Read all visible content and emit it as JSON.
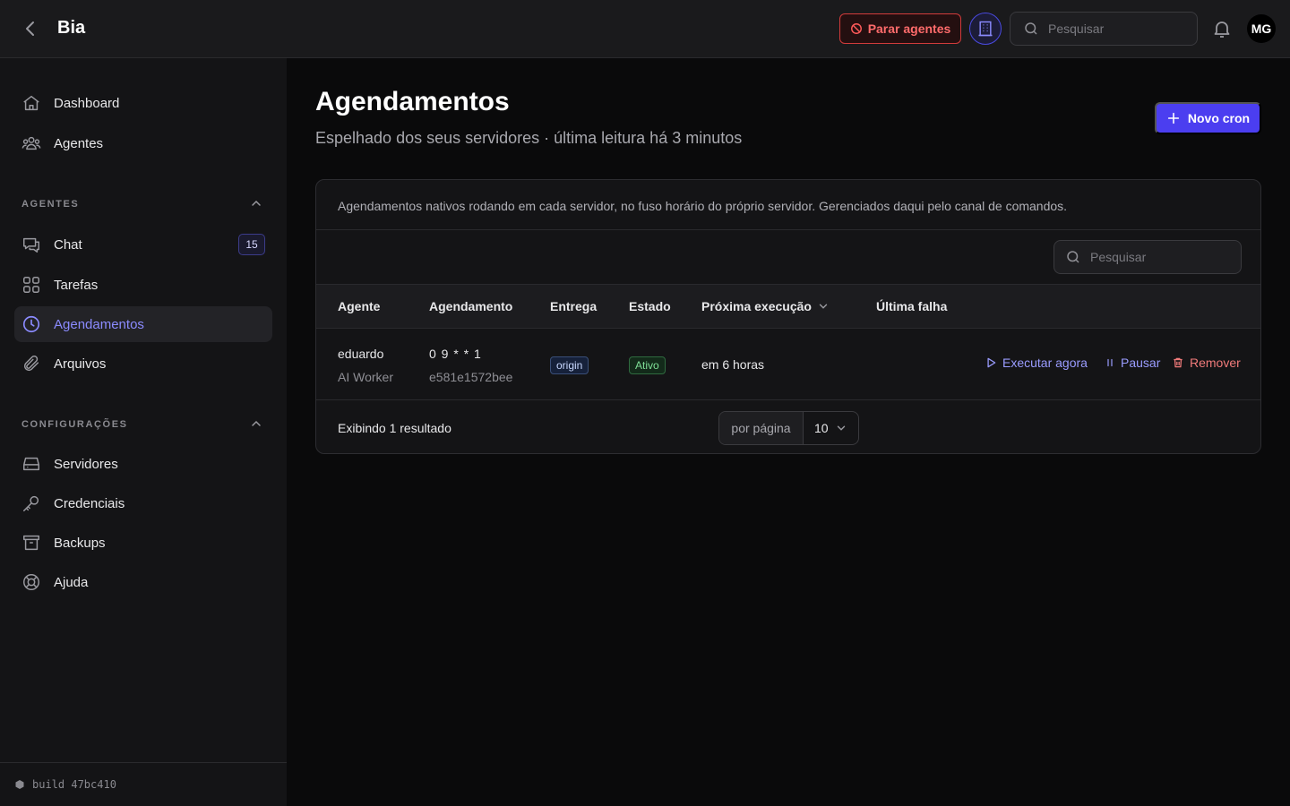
{
  "header": {
    "title": "Bia",
    "stop_label": "Parar agentes",
    "search_placeholder": "Pesquisar",
    "avatar_initials": "MG"
  },
  "sidebar": {
    "top_items": [
      {
        "label": "Dashboard",
        "icon": "home-icon"
      },
      {
        "label": "Agentes",
        "icon": "users-icon"
      }
    ],
    "section_agents": "AGENTES",
    "agent_items": [
      {
        "label": "Chat",
        "icon": "chat-icon",
        "badge": "15"
      },
      {
        "label": "Tarefas",
        "icon": "grid-icon"
      },
      {
        "label": "Agendamentos",
        "icon": "clock-icon",
        "active": true
      },
      {
        "label": "Arquivos",
        "icon": "paperclip-icon"
      }
    ],
    "section_config": "CONFIGURAÇÕES",
    "config_items": [
      {
        "label": "Servidores",
        "icon": "server-icon"
      },
      {
        "label": "Credenciais",
        "icon": "key-icon"
      },
      {
        "label": "Backups",
        "icon": "archive-icon"
      },
      {
        "label": "Ajuda",
        "icon": "lifebuoy-icon"
      }
    ],
    "build": "build 47bc410"
  },
  "main": {
    "title": "Agendamentos",
    "subtitle": "Espelhado dos seus servidores · última leitura há 3 minutos",
    "new_button": "Novo cron",
    "description": "Agendamentos nativos rodando em cada servidor, no fuso horário do próprio servidor. Gerenciados daqui pelo canal de comandos.",
    "search_placeholder": "Pesquisar",
    "columns": [
      "Agente",
      "Agendamento",
      "Entrega",
      "Estado",
      "Próxima execução",
      "Última falha"
    ],
    "rows": [
      {
        "agent": "eduardo",
        "agent_type": "AI Worker",
        "schedule": "0 9 * * 1",
        "schedule_id": "e581e1572bee",
        "delivery": "origin",
        "status": "Ativo",
        "next_run": "em 6 horas",
        "last_failure": ""
      }
    ],
    "actions": {
      "run": "Executar agora",
      "pause": "Pausar",
      "remove": "Remover"
    },
    "footer": {
      "result_count": "Exibindo 1 resultado",
      "per_page_label": "por página",
      "per_page_value": "10"
    }
  },
  "colors": {
    "accent": "#4b3ef0",
    "danger": "#d23b3b",
    "active_nav": "#8b8bff",
    "success": "#7fdf97"
  }
}
